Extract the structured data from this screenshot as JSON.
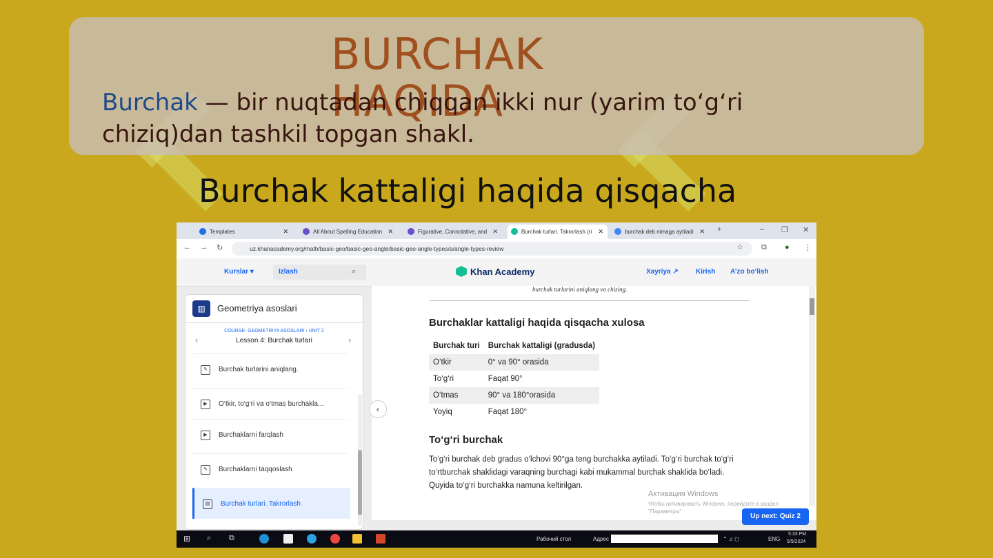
{
  "slide": {
    "title": "BURCHAK HAQIDA",
    "definition_term": "Burchak",
    "definition_rest": " — bir nuqtadan chiqqan ikki nur (yarim to‘g‘ri chiziq)dan tashkil topgan shakl.",
    "subtitle": "Burchak kattaligi haqida qisqacha"
  },
  "browser": {
    "tabs": [
      {
        "label": "Templates",
        "color": "#1a73e8"
      },
      {
        "label": "All About Spelling Education",
        "color": "#6a4fc9"
      },
      {
        "label": "Figurative, Connotative, and",
        "color": "#6a4fc9"
      },
      {
        "label": "Burchak turlari. Takrorlash (ri",
        "color": "#14bf96",
        "active": true
      },
      {
        "label": "burchak deb nimaga aytiladi",
        "color": "#4285f4"
      }
    ],
    "new_tab": "+",
    "window_controls": [
      "–",
      "❐",
      "✕"
    ],
    "url": "uz.khanacademy.org/math/basic-geo/basic-geo-angle/basic-geo-angle-types/a/angle-types-review"
  },
  "khan": {
    "nav_courses": "Kurslar",
    "search_placeholder": "Izlash",
    "logo": "Khan Academy",
    "donate": "Xayriya",
    "login": "Kirish",
    "signup": "A’zo bo‘lish"
  },
  "sidebar": {
    "course_title": "Geometriya asoslari",
    "breadcrumb": "COURSE: GEOMETRIYA ASOSLARI › UNIT 2",
    "lesson": "Lesson 4: Burchak turlari",
    "items": [
      {
        "label": "Burchak turlarini aniqlang.",
        "icon": "pencil-icon"
      },
      {
        "label": "O‘tkir, to‘g‘ri va o‘tmas burchakla...",
        "icon": "play-icon"
      },
      {
        "label": "Burchaklarni farqlash",
        "icon": "play-icon"
      },
      {
        "label": "Burchaklarni taqqoslash",
        "icon": "pencil-icon"
      },
      {
        "label": "Burchak turlari. Takrorlash",
        "icon": "article-icon",
        "active": true
      }
    ]
  },
  "article": {
    "cut_text": "burchak turlarini aniqlang va chizing.",
    "summary_heading": "Burchaklar kattaligi haqida qisqacha xulosa",
    "table_headers": [
      "Burchak turi",
      "Burchak kattaligi (gradusda)"
    ],
    "table_rows": [
      [
        "O‘tkir",
        "0° va 90° orasida"
      ],
      [
        "To‘g‘ri",
        "Faqat 90°"
      ],
      [
        "O‘tmas",
        "90° va 180°orasida"
      ],
      [
        "Yoyiq",
        "Faqat 180°"
      ]
    ],
    "right_heading": "To‘g‘ri burchak",
    "paragraph": "To‘g‘ri burchak deb gradus o‘lchovi 90°ga teng burchakka aytiladi. To‘g‘ri burchak to‘g‘ri to‘rtburchak shaklidagi varaqning burchagi kabi mukammal burchak shaklida bo‘ladi. Quyida to‘g‘ri burchakka namuna keltirilgan.",
    "up_next": "Up next: Quiz 2"
  },
  "overlay": {
    "activate_title": "Активация Windows",
    "activate_sub": "Чтобы активировать Windows, перейдите в раздел \"Параметры\"."
  },
  "taskbar": {
    "desktop": "Рабочий стол",
    "address": "Адрес",
    "lang": "ENG",
    "time": "5:33 PM",
    "date": "5/9/2024"
  },
  "colors": {
    "slide_bg": "#c9a81d",
    "accent": "#1865f2",
    "title": "#a0501e"
  }
}
